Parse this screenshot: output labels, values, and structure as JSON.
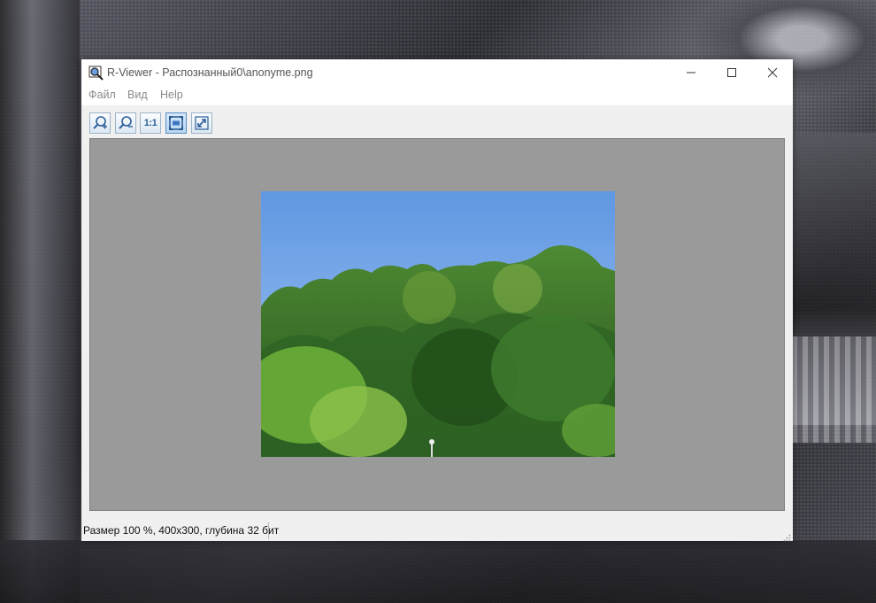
{
  "window": {
    "title": "R-Viewer - Распознанный0\\anonyme.png",
    "icon": "app-viewer-icon",
    "controls": {
      "minimize": "minimize-icon",
      "maximize": "maximize-icon",
      "close": "close-icon"
    }
  },
  "menu": {
    "items": [
      {
        "label": "Файл"
      },
      {
        "label": "Вид"
      },
      {
        "label": "Help"
      }
    ]
  },
  "toolbar": {
    "buttons": [
      {
        "icon": "zoom-in-icon"
      },
      {
        "icon": "zoom-out-icon"
      },
      {
        "icon": "actual-size-icon",
        "label": "1:1"
      },
      {
        "icon": "fit-window-icon",
        "active": true
      },
      {
        "icon": "fullscreen-icon"
      }
    ]
  },
  "image": {
    "description": "photo-trees-sky",
    "viewport_bg": "#9a9a9a"
  },
  "status": {
    "text": "Размер 100 %, 400x300, глубина 32 бит"
  },
  "colors": {
    "accent": "#2e6fc0",
    "sky": "#7fb0ee",
    "foliage": "#3f7a2a"
  }
}
